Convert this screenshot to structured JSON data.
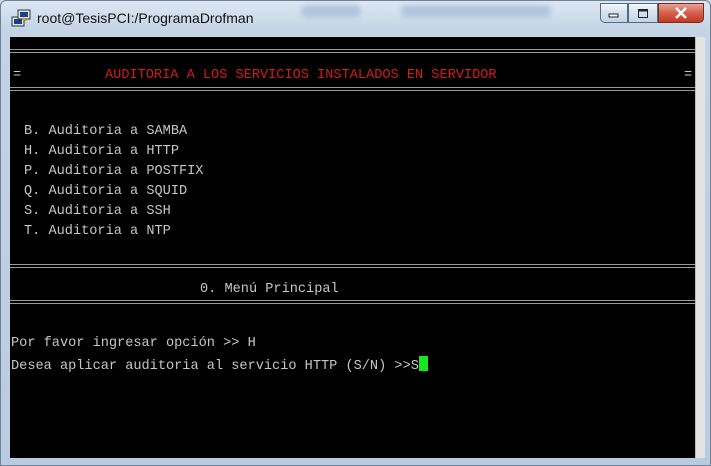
{
  "window": {
    "title": "root@TesisPCI:/ProgramaDrofman",
    "controls": {
      "minimize": "minimize-icon",
      "maximize": "maximize-icon",
      "close": "close-icon"
    }
  },
  "terminal": {
    "header_left": "=",
    "header_title": "AUDITORIA A LOS SERVICIOS INSTALADOS EN SERVIDOR",
    "header_right": "=",
    "menu_items": [
      "B. Auditoria a SAMBA",
      "H. Auditoria a HTTP",
      "P. Auditoria a POSTFIX",
      "Q. Auditoria a SQUID",
      "S. Auditoria a SSH",
      "T. Auditoria a NTP"
    ],
    "main_menu": "0. Menú Principal",
    "prompt_line": "Por favor ingresar opción >> H",
    "confirm_prompt": "Desea aplicar auditoria al servicio HTTP (S/N) >>",
    "confirm_input": "S"
  },
  "colors": {
    "background": "#000000",
    "text": "#c6c6c6",
    "header": "#d21b1b",
    "cursor": "#17e81c"
  }
}
